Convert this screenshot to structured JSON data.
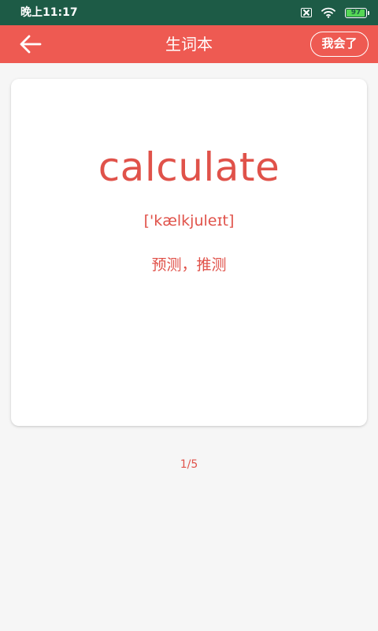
{
  "status_bar": {
    "time": "晚上11:17",
    "battery_level": "97",
    "battery_fill_percent": 97,
    "icons": [
      "sim-off-icon",
      "wifi-icon",
      "battery-icon"
    ]
  },
  "header": {
    "title": "生词本",
    "know_button_label": "我会了",
    "back_icon": "arrow-left-icon"
  },
  "card": {
    "word": "calculate",
    "phonetic": "['kælkjuleɪt]",
    "meaning": "预测，推测"
  },
  "pagination": {
    "text": "1/5"
  },
  "colors": {
    "status_bar": "#1d5b46",
    "accent": "#ee5a52",
    "text_accent": "#e0524a",
    "background": "#f6f6f6",
    "card": "#ffffff"
  }
}
